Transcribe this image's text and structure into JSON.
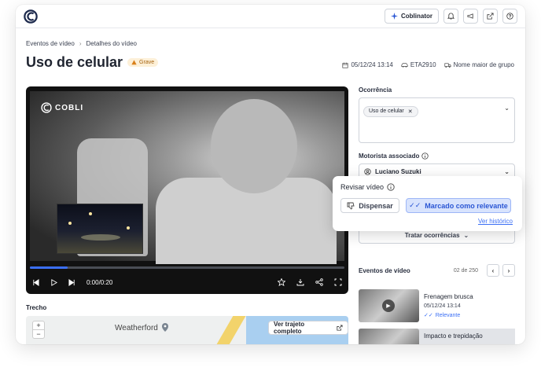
{
  "topbar": {
    "app_button_label": "Coblinator",
    "icons": [
      "sparkle-icon",
      "bell-icon",
      "megaphone-icon",
      "external-link-icon",
      "help-icon"
    ]
  },
  "breadcrumb": {
    "parent": "Eventos de vídeo",
    "current": "Detalhes do vídeo"
  },
  "event": {
    "title": "Uso de celular",
    "severity": "Grave",
    "datetime": "05/12/24 13:14",
    "vehicle": "ETA2910",
    "group": "Nome maior de grupo"
  },
  "video": {
    "watermark": "COBLI",
    "time": "0:00/0:20",
    "progress": 0.12
  },
  "trecho": {
    "label": "Trecho",
    "town": "Weatherford",
    "route_button": "Ver trajeto completo",
    "zoom_in": "+",
    "zoom_out": "−"
  },
  "occurrence": {
    "label": "Ocorrência",
    "chip": "Uso de celular"
  },
  "driver": {
    "label": "Motorista associado",
    "name": "Luciano Suzuki"
  },
  "review": {
    "title": "Revisar vídeo",
    "dismiss": "Dispensar",
    "relevant": "Marcado como relevante",
    "history": "Ver histórico"
  },
  "treat_button": "Tratar ocorrências",
  "events_list": {
    "title": "Eventos de vídeo",
    "count": "02 de 250",
    "items": [
      {
        "name": "Frenagem brusca",
        "datetime": "05/12/24 13:14",
        "status": "Relevante"
      },
      {
        "name": "Impacto e trepidação"
      }
    ]
  },
  "colors": {
    "accent": "#3b6ff5",
    "severity_bg": "#fdf0d8",
    "severity_fg": "#a5620d"
  }
}
